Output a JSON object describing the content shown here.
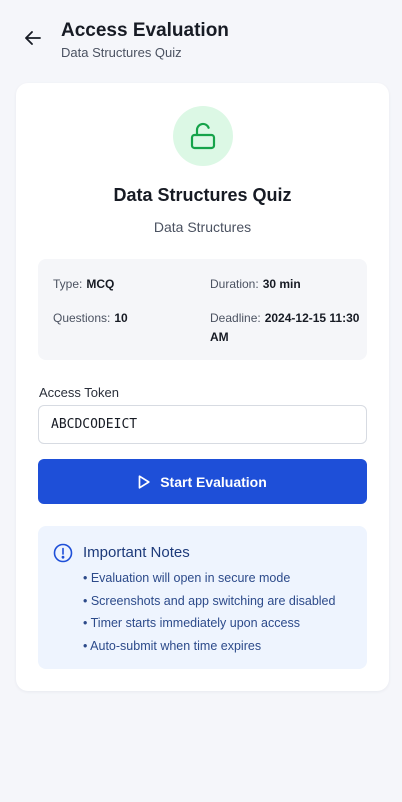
{
  "header": {
    "title": "Access Evaluation",
    "subtitle": "Data Structures Quiz"
  },
  "quiz": {
    "title": "Data Structures Quiz",
    "subject": "Data Structures",
    "lock_icon": "unlock-icon",
    "lock_icon_color": "#16a34a"
  },
  "info": {
    "type_label": "Type:",
    "type_value": "MCQ",
    "duration_label": "Duration:",
    "duration_value": "30 min",
    "questions_label": "Questions:",
    "questions_value": "10",
    "deadline_label": "Deadline:",
    "deadline_value": "2024-12-15 11:30 AM"
  },
  "token": {
    "label": "Access Token",
    "value": "ABCDCODEICT"
  },
  "start_button": {
    "label": "Start Evaluation",
    "icon": "play-icon",
    "color": "#1e4fd8"
  },
  "notes": {
    "title": "Important Notes",
    "icon": "info-icon",
    "items": [
      "• Evaluation will open in secure mode",
      "• Screenshots and app switching are disabled",
      "• Timer starts immediately upon access",
      "• Auto-submit when time expires"
    ]
  }
}
